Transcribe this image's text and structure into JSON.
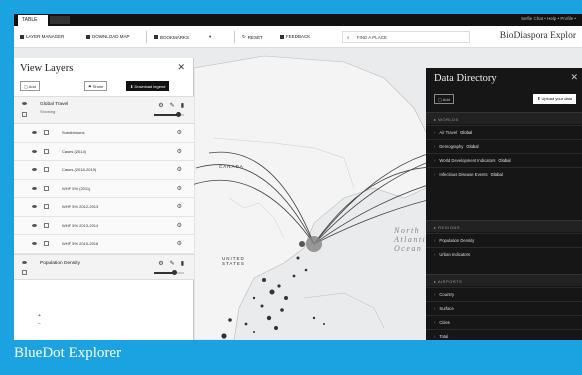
{
  "caption": "BlueDot Explorer",
  "browser": {
    "tab": "TABLE",
    "links": "Selfie Chat  •  Help  •  Profile  •"
  },
  "toolbar": {
    "layer_manager": "LAYER MANAGER",
    "download_map": "DOWNLOAD MAP",
    "bookmarks": "BOOKMARKS",
    "reset": "RESET",
    "feedback": "FEEDBACK",
    "search_placeholder": "FIND A PLACE",
    "app_title": "BioDiaspora Explor"
  },
  "view_layers": {
    "title": "View Layers",
    "buttons": {
      "add": "Add",
      "share": "Share",
      "download": "Download legend"
    },
    "group1": {
      "name": "Global Travel",
      "sub": "Showing"
    },
    "rows": [
      "Subdivisions",
      "Cases (2014)",
      "Cases (2018-2019)",
      "WHF 5% (2011)",
      "WHF 5% 2012-2013",
      "WHF 5% 2013-2014",
      "WHF 5% 2015-2016"
    ],
    "group2": {
      "name": "Population Density"
    },
    "zoom": [
      "+",
      "−"
    ]
  },
  "data_directory": {
    "title": "Data Directory",
    "buttons": {
      "add": "Add",
      "upload": "Upload your data"
    },
    "sections": [
      {
        "label": "WORLDS",
        "items": [
          {
            "name": "Air Travel",
            "tag": "Global"
          },
          {
            "name": "Demography",
            "tag": "Global"
          },
          {
            "name": "World Development Indicators",
            "tag": "Global"
          },
          {
            "name": "Infectious Disease Events",
            "tag": "Global"
          }
        ]
      },
      {
        "label": "REGIONS",
        "items": [
          {
            "name": "Population Density",
            "tag": ""
          },
          {
            "name": "Urban Indicators",
            "tag": ""
          }
        ]
      },
      {
        "label": "AIRPORTS",
        "items": [
          {
            "name": "Country",
            "tag": ""
          },
          {
            "name": "Surface",
            "tag": ""
          },
          {
            "name": "Cities",
            "tag": ""
          },
          {
            "name": "Total",
            "tag": ""
          }
        ]
      }
    ]
  },
  "map": {
    "labels": {
      "canada": "CANADA",
      "united_states": "UNITED\nSTATES",
      "ocean": "North\nAtlanti\nOcean"
    }
  },
  "colors": {
    "frame": "#1aa3e0",
    "panel_dark": "#161616"
  }
}
